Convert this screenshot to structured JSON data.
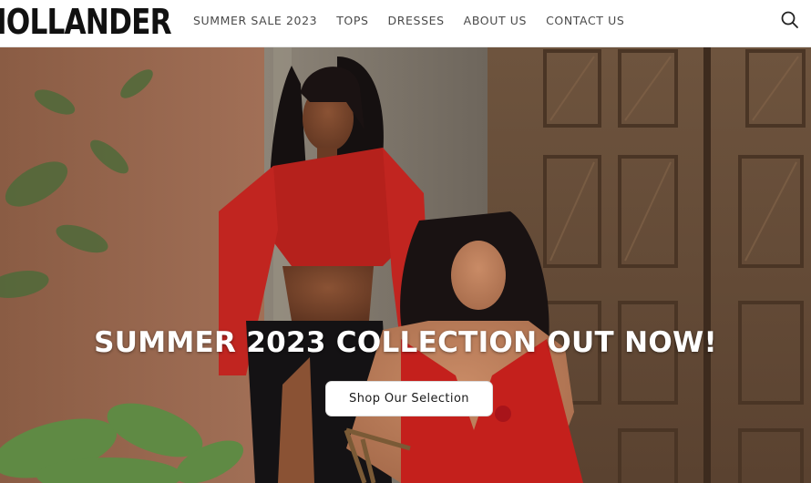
{
  "brand": {
    "logo_text": "IOLLANDER"
  },
  "nav": {
    "items": [
      {
        "label": "SUMMER SALE 2023"
      },
      {
        "label": "TOPS"
      },
      {
        "label": "DRESSES"
      },
      {
        "label": "ABOUT US"
      },
      {
        "label": "CONTACT US"
      }
    ]
  },
  "search": {
    "icon": "search-icon"
  },
  "hero": {
    "title": "SUMMER 2023 COLLECTION OUT NOW!",
    "button_label": "Shop Our Selection"
  },
  "colors": {
    "header_bg": "#ffffff",
    "nav_text": "#4a4a4a",
    "hero_title": "#ffffff",
    "button_bg": "#ffffff",
    "accent_red": "#c4201c"
  }
}
